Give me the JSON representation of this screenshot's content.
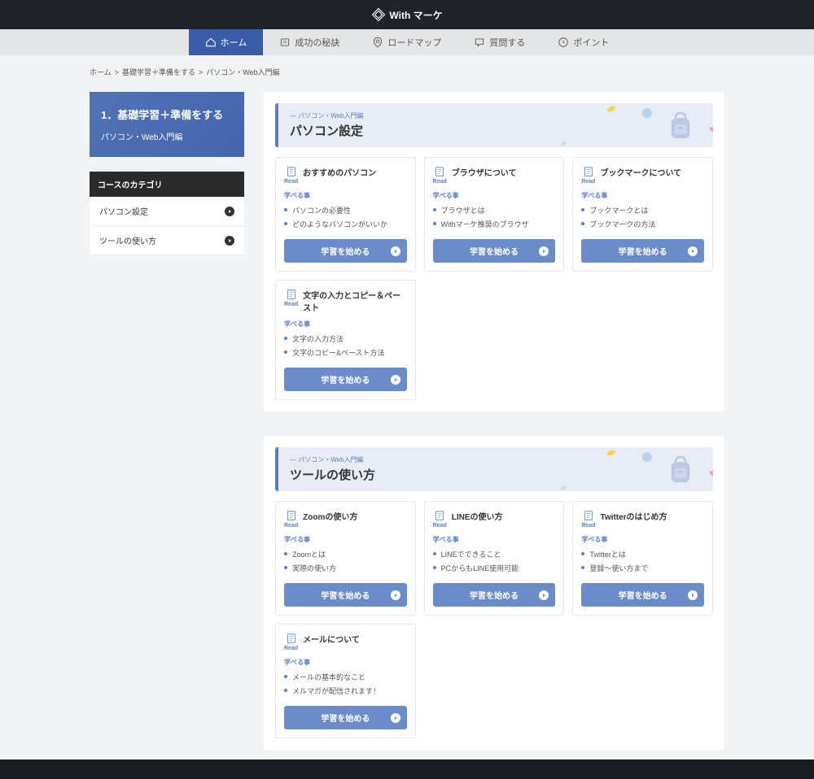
{
  "brand": "With マーケ",
  "nav": [
    {
      "label": "ホーム",
      "active": true
    },
    {
      "label": "成功の秘訣",
      "active": false
    },
    {
      "label": "ロードマップ",
      "active": false
    },
    {
      "label": "質問する",
      "active": false
    },
    {
      "label": "ポイント",
      "active": false
    }
  ],
  "breadcrumb": [
    "ホーム",
    "基礎学習＋準備をする",
    "パソコン・Web入門編"
  ],
  "hero": {
    "title": "1．基礎学習＋準備をする",
    "subtitle": "パソコン・Web入門編"
  },
  "category": {
    "header": "コースのカテゴリ",
    "items": [
      "パソコン設定",
      "ツールの使い方"
    ]
  },
  "common": {
    "read": "Read",
    "learnLabel": "学べる事",
    "btn": "学習を始める",
    "sectionSub": "パソコン・Web入門編"
  },
  "sections": [
    {
      "title": "パソコン設定",
      "cards": [
        {
          "title": "おすすめのパソコン",
          "points": [
            "パソコンの必要性",
            "どのようなパソコンがいいか"
          ]
        },
        {
          "title": "ブラウザについて",
          "points": [
            "ブラウザとは",
            "Withマーケ推奨のブラウザ"
          ]
        },
        {
          "title": "ブックマークについて",
          "points": [
            "ブックマークとは",
            "ブックマークの方法"
          ]
        },
        {
          "title": "文字の入力とコピー＆ペースト",
          "points": [
            "文字の入力方法",
            "文字のコピー&ペースト方法"
          ]
        }
      ]
    },
    {
      "title": "ツールの使い方",
      "cards": [
        {
          "title": "Zoomの使い方",
          "points": [
            "Zoomとは",
            "実際の使い方"
          ]
        },
        {
          "title": "LINEの使い方",
          "points": [
            "LINEでできること",
            "PCからもLINE使用可能"
          ]
        },
        {
          "title": "Twitterのはじめ方",
          "points": [
            "Twitterとは",
            "登録～使い方まで"
          ]
        },
        {
          "title": "メールについて",
          "points": [
            "メールの基本的なこと",
            "メルマガが配信されます！"
          ]
        }
      ]
    }
  ]
}
